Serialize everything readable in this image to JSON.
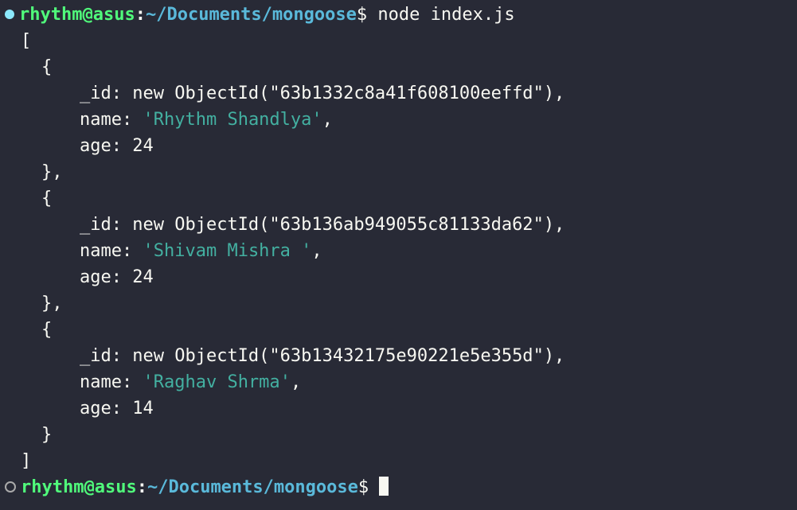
{
  "prompt1": {
    "user": "rhythm",
    "host": "asus",
    "path": "~/Documents/mongoose",
    "command": "node index.js"
  },
  "output": {
    "records": [
      {
        "id": "63b1332c8a41f608100eeffd",
        "name": "Rhythm Shandlya",
        "age": "24"
      },
      {
        "id": "63b136ab949055c81133da62",
        "name": "Shivam Mishra ",
        "age": "24"
      },
      {
        "id": "63b13432175e90221e5e355d",
        "name": "Raghav Shrma",
        "age": "14"
      }
    ]
  },
  "prompt2": {
    "user": "rhythm",
    "host": "asus",
    "path": "~/Documents/mongoose"
  }
}
